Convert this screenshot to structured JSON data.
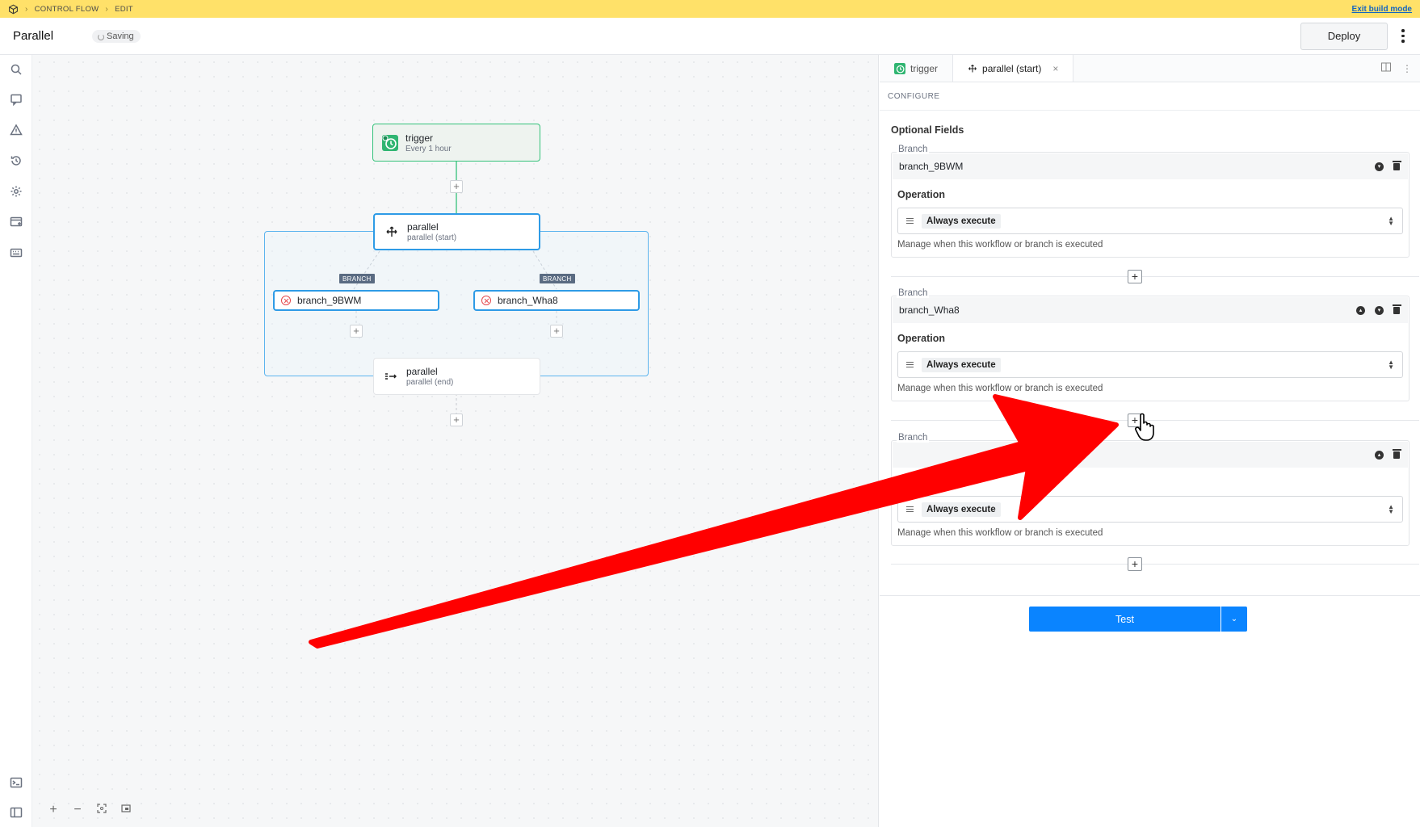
{
  "build_bar": {
    "crumbs": [
      "CONTROL FLOW",
      "EDIT"
    ],
    "exit_label": "Exit build mode"
  },
  "header": {
    "title": "Parallel",
    "status": "Saving",
    "deploy_label": "Deploy"
  },
  "canvas": {
    "trigger": {
      "title": "trigger",
      "subtitle": "Every 1 hour"
    },
    "parallel_start": {
      "title": "parallel",
      "subtitle": "parallel (start)"
    },
    "parallel_end": {
      "title": "parallel",
      "subtitle": "parallel (end)"
    },
    "branch_tag": "BRANCH",
    "branches": [
      "branch_9BWM",
      "branch_Wha8"
    ]
  },
  "panel": {
    "tabs": [
      {
        "label": "trigger"
      },
      {
        "label": "parallel (start)"
      }
    ],
    "section": "CONFIGURE",
    "optional_fields": "Optional Fields",
    "branch_label": "Branch",
    "operation_label": "Operation",
    "branches": [
      {
        "name": "branch_9BWM",
        "operation": "Always execute",
        "help": "Manage when this workflow or branch is executed"
      },
      {
        "name": "branch_Wha8",
        "operation": "Always execute",
        "help": "Manage when this workflow or branch is executed"
      },
      {
        "name": "",
        "operation": "Always execute",
        "help": "Manage when this workflow or branch is executed"
      }
    ],
    "test_label": "Test"
  },
  "colors": {
    "build_bar": "#ffe169",
    "accent_blue": "#0a84ff",
    "node_border": "#2e9be6",
    "trigger_green": "#34c27a",
    "error_red": "#e5484d",
    "annotation_arrow": "#ff0000"
  },
  "icons": {
    "rail_top": [
      "search-icon",
      "comment-icon",
      "warning-icon",
      "history-icon",
      "gear-icon",
      "app-window-icon",
      "keyboard-icon"
    ],
    "rail_bottom": [
      "terminal-icon",
      "panel-layout-icon"
    ],
    "zoom": [
      "zoom-in-icon",
      "zoom-out-icon",
      "fit-view-icon",
      "minimap-icon"
    ]
  }
}
